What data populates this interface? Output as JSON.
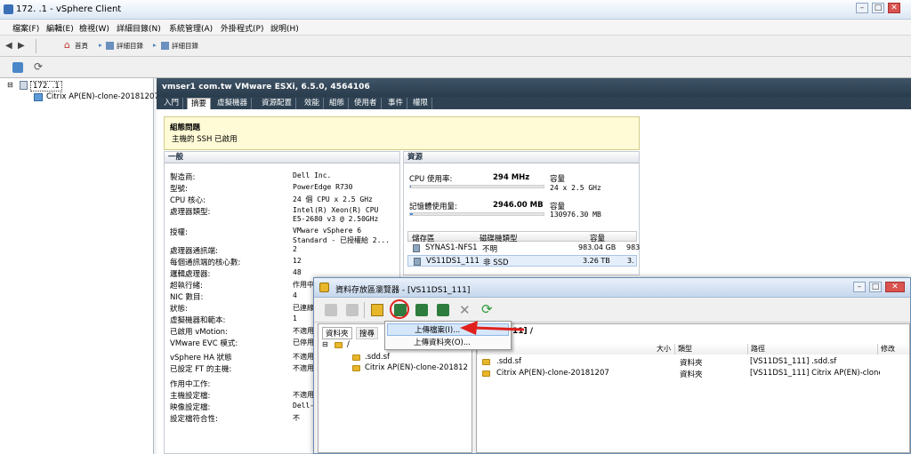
{
  "window": {
    "title": "172.          .1 - vSphere Client"
  },
  "menu": [
    "檔案(F)",
    "編輯(E)",
    "檢視(W)",
    "詳細目錄(N)",
    "系統管理(A)",
    "外掛程式(P)",
    "說明(H)"
  ],
  "nav": {
    "home": "首頁",
    "crumb1": "詳細目錄",
    "crumb2": "詳細目錄"
  },
  "tree": {
    "host": "172.          .1",
    "vm": "Citrix AP(EN)-clone-20181207"
  },
  "host_header": "vmser1              com.tw VMware ESXi, 6.5.0, 4564106",
  "tabs": [
    "入門",
    "摘要",
    "虛擬機器",
    "資源配置",
    "效能",
    "組態",
    "使用者",
    "事件",
    "權限"
  ],
  "active_tab": "摘要",
  "issues": {
    "title": "組態問題",
    "text": "主機的 SSH 已啟用"
  },
  "general": {
    "title": "一般",
    "rows": [
      {
        "label": "製造商:",
        "value": "Dell Inc."
      },
      {
        "label": "型號:",
        "value": "PowerEdge R730"
      },
      {
        "label": "CPU 核心:",
        "value": "24 個 CPU x 2.5 GHz"
      },
      {
        "label": "處理器類型:",
        "value": "Intel(R) Xeon(R) CPU"
      },
      {
        "label": "",
        "value": "E5-2680 v3 @ 2.50GHz"
      },
      {
        "label": "授權:",
        "value": "VMware vSphere 6"
      },
      {
        "label": "",
        "value": "Standard - 已授權給 2..."
      },
      {
        "label": "處理器通訊端:",
        "value": "2"
      },
      {
        "label": "每個通訊端的核心數:",
        "value": "12"
      },
      {
        "label": "邏輯處理器:",
        "value": "48"
      },
      {
        "label": "超執行緒:",
        "value": "作用中"
      },
      {
        "label": "NIC 數目:",
        "value": "4"
      },
      {
        "label": "狀態:",
        "value": "已連線"
      },
      {
        "label": "虛擬機器和範本:",
        "value": "1"
      },
      {
        "label": "已啟用 vMotion:",
        "value": "不適用"
      },
      {
        "label": "VMware EVC 模式:",
        "value": "已停用"
      },
      {
        "label": "vSphere HA 狀態",
        "value": "不適用"
      },
      {
        "label": "已設定 FT 的主機:",
        "value": "不適用"
      },
      {
        "label": "作用中工作:",
        "value": ""
      },
      {
        "label": "主機設定檔:",
        "value": "不適用"
      },
      {
        "label": "映像設定檔:",
        "value": "Dell-"
      },
      {
        "label": "設定檔符合性:",
        "value": "不"
      }
    ]
  },
  "resources": {
    "title": "資源",
    "cpu_label": "CPU 使用率:",
    "cpu_value": "294 MHz",
    "cpu_cap_label": "容量",
    "cpu_cap": "24 x 2.5 GHz",
    "cpu_used_fraction": 0.005,
    "mem_label": "記憶體使用量:",
    "mem_value": "2946.00 MB",
    "mem_cap_label": "容量",
    "mem_cap": "130976.30 MB",
    "mem_used_fraction": 0.022,
    "ds_cols": [
      "儲存區",
      "磁碟機類型",
      "容量"
    ],
    "datastores": [
      {
        "name": "SYNAS1-NFS1",
        "type": "不明",
        "cap": "983.04 GB",
        "extra": "983"
      },
      {
        "name": "VS11DS1_111",
        "type": "非 SSD",
        "cap": "3.26 TB",
        "extra": "3."
      }
    ]
  },
  "browser": {
    "title": "資料存放區瀏覽器 - [VS11DS1_111]",
    "left_tabs": [
      "資料夾",
      "搜尋"
    ],
    "root": "/",
    "tree_items": [
      ".sdd.sf",
      "Citrix AP(EN)-clone-201812"
    ],
    "path_label": "[VS11DS1_111] /",
    "path_visible": "11] /",
    "cols": [
      "大小",
      "類型",
      "路徑",
      "修改"
    ],
    "files": [
      {
        "name": ".sdd.sf",
        "type": "資料夾",
        "path": "[VS11DS1_111] .sdd.sf"
      },
      {
        "name": "Citrix AP(EN)-clone-20181207",
        "type": "資料夾",
        "path": "[VS11DS1_111] Citrix AP(EN)-clone-"
      }
    ]
  },
  "context_menu": [
    "上傳檔案(I)...",
    "上傳資料夾(O)..."
  ],
  "colors": {
    "accent_red": "#e0201c",
    "header_dark": "#2e4253"
  }
}
